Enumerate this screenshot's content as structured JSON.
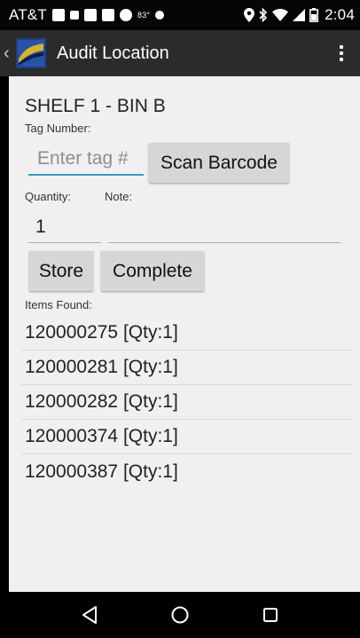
{
  "status_bar": {
    "carrier": "AT&T",
    "temperature": "83°",
    "time": "2:04"
  },
  "action_bar": {
    "title": "Audit Location"
  },
  "form": {
    "location": "SHELF 1 - BIN B",
    "tag_label": "Tag Number:",
    "tag_placeholder": "Enter tag #",
    "tag_value": "",
    "scan_label": "Scan Barcode",
    "quantity_label": "Quantity:",
    "quantity_value": "1",
    "note_label": "Note:",
    "note_value": "",
    "store_label": "Store",
    "complete_label": "Complete",
    "items_label": "Items Found:"
  },
  "items": [
    "120000275 [Qty:1]",
    "120000281 [Qty:1]",
    "120000282 [Qty:1]",
    "120000374 [Qty:1]",
    "120000387 [Qty:1]"
  ],
  "colors": {
    "status_bar": "#050505",
    "action_bar": "#2b2b2b",
    "content_bg": "#f0f0f0",
    "accent": "#2aa3c7",
    "button": "#d6d6d6"
  },
  "icons": {
    "back": "back-triangle-icon",
    "home": "home-circle-icon",
    "recents": "recents-square-icon",
    "overflow": "more-vertical-icon"
  }
}
